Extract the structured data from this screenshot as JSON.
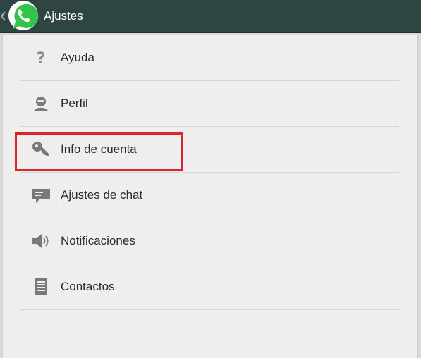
{
  "app_bar": {
    "title": "Ajustes",
    "back_icon": "chevron-left-icon",
    "logo_icon": "whatsapp-logo",
    "background": "#2f4544"
  },
  "settings": {
    "items": [
      {
        "label": "Ayuda",
        "icon": "help-icon"
      },
      {
        "label": "Perfil",
        "icon": "profile-icon"
      },
      {
        "label": "Info de cuenta",
        "icon": "key-icon",
        "highlighted": true
      },
      {
        "label": "Ajustes de chat",
        "icon": "chat-icon"
      },
      {
        "label": "Notificaciones",
        "icon": "speaker-icon"
      },
      {
        "label": "Contactos",
        "icon": "contacts-icon"
      }
    ]
  },
  "colors": {
    "highlight_border": "#e0232b",
    "whatsapp_green": "#33c44b",
    "panel_background": "#eeeeee"
  }
}
